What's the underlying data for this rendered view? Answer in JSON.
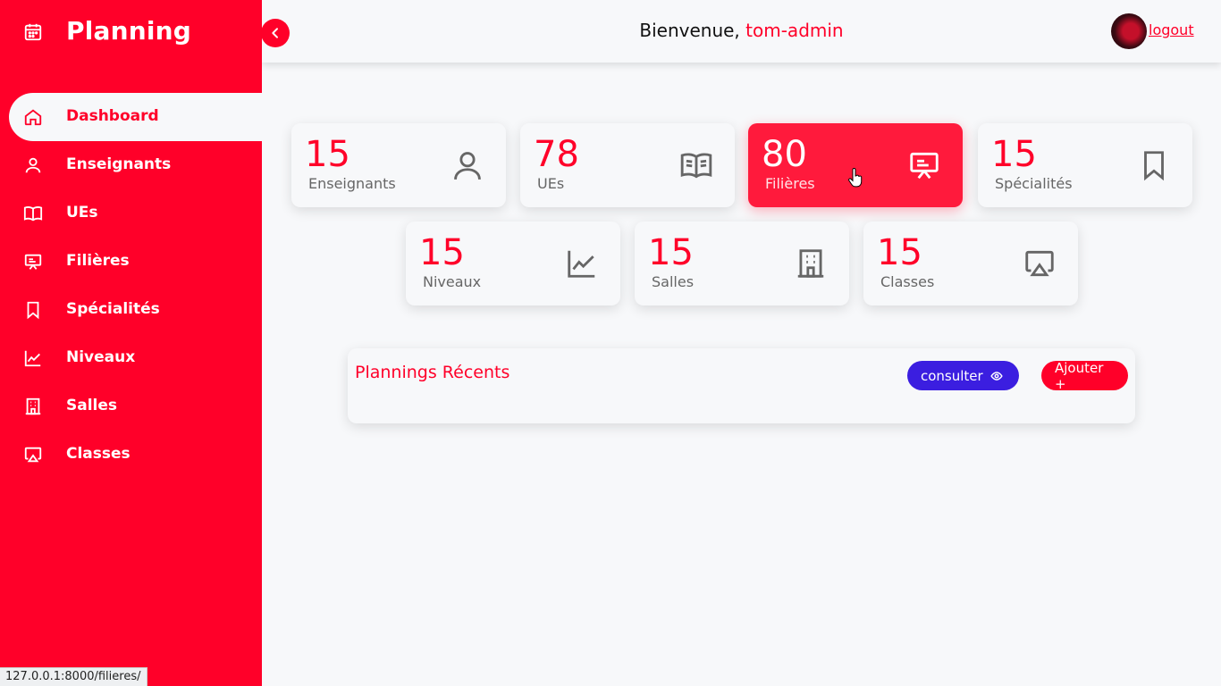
{
  "app": {
    "title": "Planning"
  },
  "sidebar": {
    "items": [
      {
        "label": "Dashboard",
        "icon": "home-icon",
        "active": true
      },
      {
        "label": "Enseignants",
        "icon": "user-icon"
      },
      {
        "label": "UEs",
        "icon": "book-icon"
      },
      {
        "label": "Filières",
        "icon": "presentation-icon"
      },
      {
        "label": "Spécialités",
        "icon": "bookmark-icon"
      },
      {
        "label": "Niveaux",
        "icon": "chart-line-icon"
      },
      {
        "label": "Salles",
        "icon": "building-icon"
      },
      {
        "label": "Classes",
        "icon": "airplay-icon"
      }
    ]
  },
  "header": {
    "welcome_prefix": "Bienvenue,",
    "username": "tom-admin",
    "logout_label": "logout"
  },
  "stats": [
    {
      "value": "15",
      "label": "Enseignants",
      "icon": "user-icon"
    },
    {
      "value": "78",
      "label": "UEs",
      "icon": "book-icon"
    },
    {
      "value": "80",
      "label": "Filières",
      "icon": "presentation-icon",
      "highlighted": true
    },
    {
      "value": "15",
      "label": "Spécialités",
      "icon": "bookmark-icon"
    },
    {
      "value": "15",
      "label": "Niveaux",
      "icon": "chart-line-icon"
    },
    {
      "value": "15",
      "label": "Salles",
      "icon": "building-icon"
    },
    {
      "value": "15",
      "label": "Classes",
      "icon": "airplay-icon"
    }
  ],
  "recent": {
    "title": "Plannings Récents",
    "consult_label": "consulter",
    "add_label": "Ajouter +"
  },
  "status_bar": {
    "url": "127.0.0.1:8000/filieres/"
  },
  "colors": {
    "accent": "#ff0029",
    "consult": "#3b1ee0",
    "background": "#f7f8fa",
    "icon_gray": "#666666"
  }
}
